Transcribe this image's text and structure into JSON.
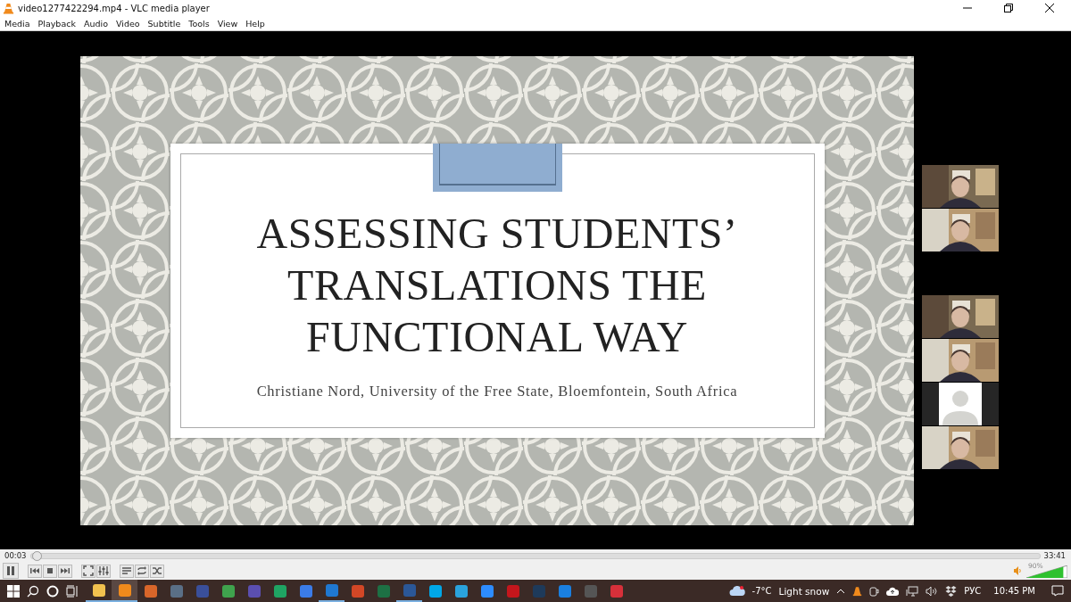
{
  "window": {
    "title": "video1277422294.mp4 - VLC media player"
  },
  "menu": [
    "Media",
    "Playback",
    "Audio",
    "Video",
    "Subtitle",
    "Tools",
    "View",
    "Help"
  ],
  "slide": {
    "title": "ASSESSING STUDENTS’ TRANSLATIONS THE FUNCTIONAL WAY",
    "subtitle": "Christiane Nord, University of the Free State, Bloemfontein, South Africa"
  },
  "participant_groups": [
    [
      {
        "kind": "video"
      },
      {
        "kind": "video"
      }
    ],
    [
      {
        "kind": "video"
      },
      {
        "kind": "video"
      },
      {
        "kind": "avatar"
      },
      {
        "kind": "video"
      }
    ]
  ],
  "player": {
    "elapsed": "00:03",
    "total": "33:41",
    "seek": {
      "level": 0.002
    },
    "volume_label": "90%",
    "volume": {
      "level": 0.9
    }
  },
  "controls": [
    {
      "kind": "pause"
    },
    {
      "kind": "prev"
    },
    {
      "kind": "stop"
    },
    {
      "kind": "next"
    },
    {
      "kind": "fullscreen"
    },
    {
      "kind": "settings"
    },
    {
      "kind": "playlist"
    },
    {
      "kind": "loop"
    },
    {
      "kind": "shuffle"
    }
  ],
  "taskbar": {
    "apps": [
      {
        "color": "#f2c14e",
        "running": true,
        "selected": false
      },
      {
        "color": "#f08a1c",
        "running": true,
        "selected": true
      },
      {
        "color": "#d9662a",
        "running": false,
        "selected": false
      },
      {
        "color": "#5a6f86",
        "running": false,
        "selected": false
      },
      {
        "color": "#3a4f9a",
        "running": false,
        "selected": false
      },
      {
        "color": "#3fa34d",
        "running": false,
        "selected": false
      },
      {
        "color": "#5b4fb0",
        "running": false,
        "selected": false
      },
      {
        "color": "#1fa463",
        "running": false,
        "selected": false
      },
      {
        "color": "#3b7ce8",
        "running": false,
        "selected": false
      },
      {
        "color": "#1f78d1",
        "running": true,
        "selected": false
      },
      {
        "color": "#d24726",
        "running": false,
        "selected": false
      },
      {
        "color": "#1d7044",
        "running": false,
        "selected": false
      },
      {
        "color": "#2b5797",
        "running": true,
        "selected": false
      },
      {
        "color": "#00a7e7",
        "running": false,
        "selected": false
      },
      {
        "color": "#2aa3dd",
        "running": false,
        "selected": false
      },
      {
        "color": "#2d8cff",
        "running": false,
        "selected": false
      },
      {
        "color": "#c4161c",
        "running": false,
        "selected": false
      },
      {
        "color": "#1e3a5a",
        "running": false,
        "selected": false
      },
      {
        "color": "#1a7fe0",
        "running": false,
        "selected": false
      },
      {
        "color": "#555555",
        "running": false,
        "selected": false
      },
      {
        "color": "#d7303a",
        "running": false,
        "selected": false
      }
    ],
    "temperature": "-7°C",
    "weather": "Light snow",
    "language": "РУС",
    "clock": "10:45 PM"
  }
}
